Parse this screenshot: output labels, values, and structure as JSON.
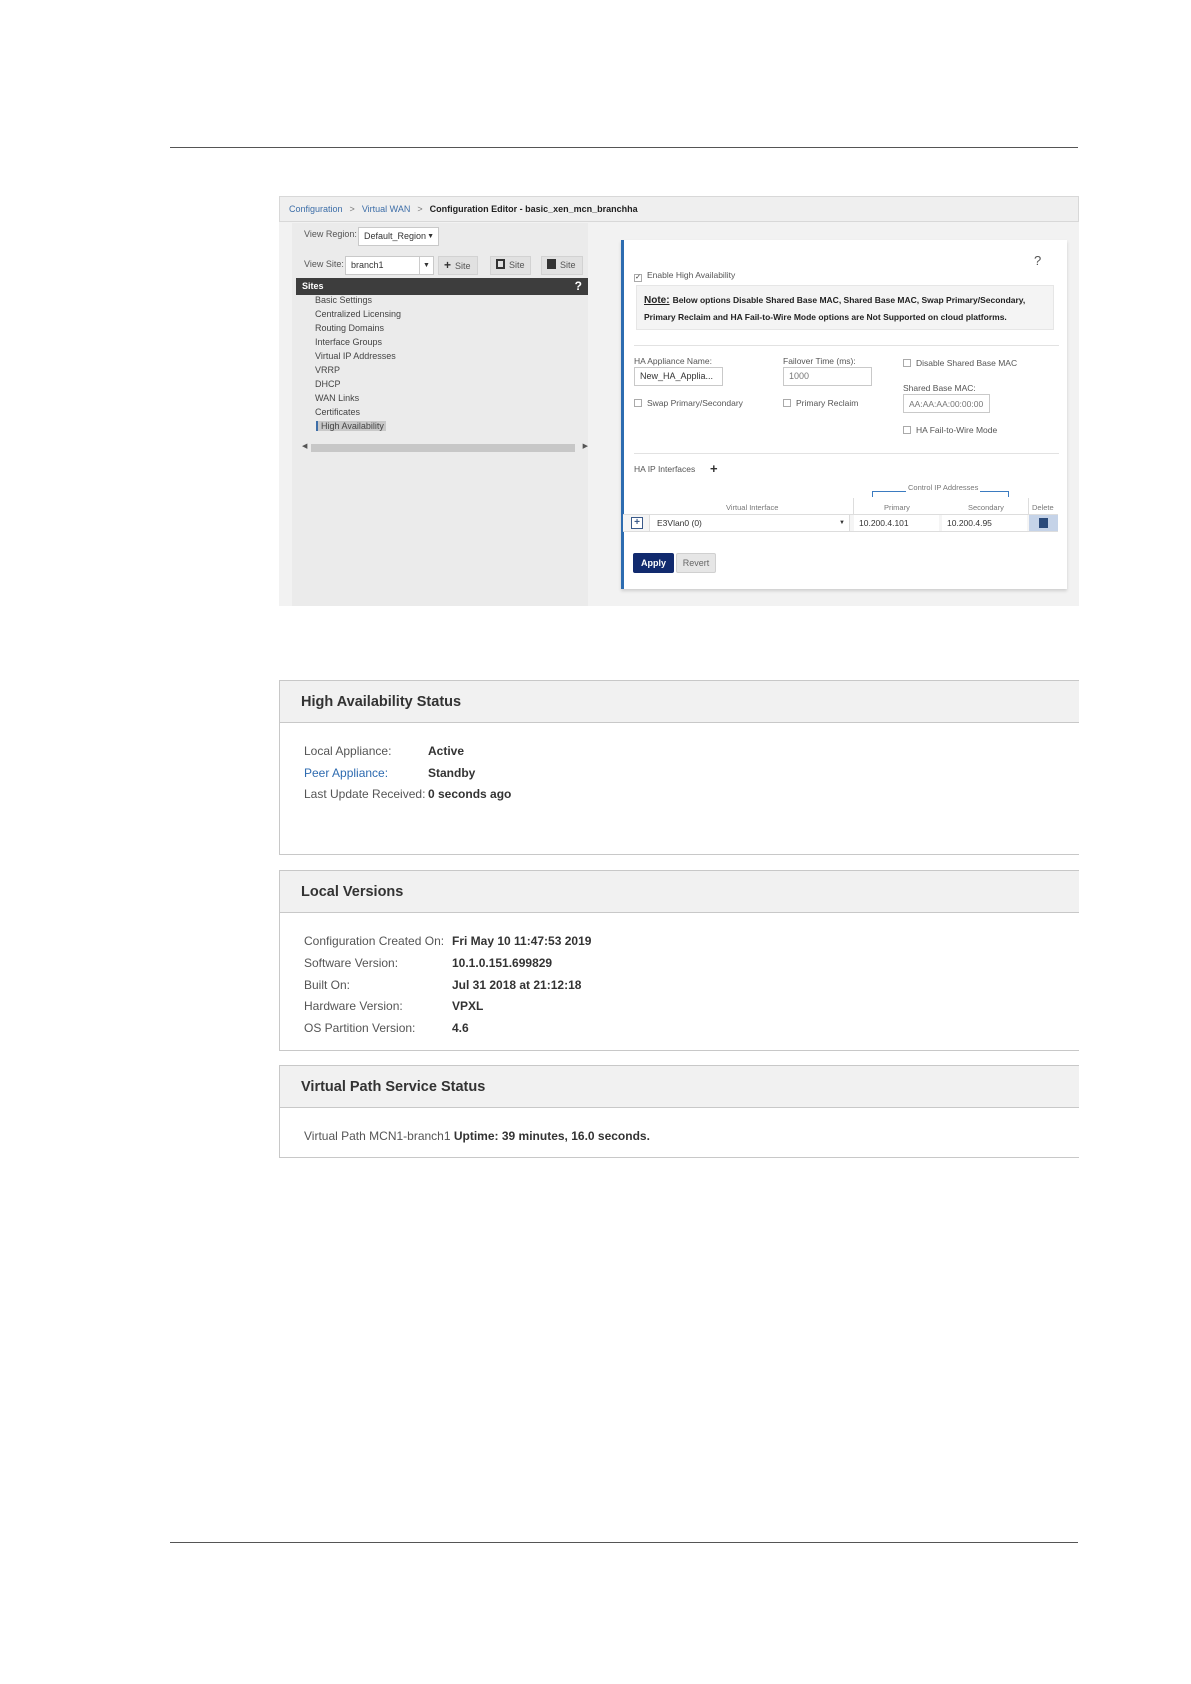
{
  "breadcrumb": {
    "items": [
      "Configuration",
      "Virtual WAN"
    ],
    "separator": ">",
    "current": "Configuration Editor - basic_xen_mcn_branchha"
  },
  "left_pane": {
    "view_region_label": "View Region:",
    "view_region_value": "Default_Region",
    "view_site_label": "View Site:",
    "view_site_value": "branch1",
    "toolbar": [
      {
        "icon": "plus-icon",
        "label": "Site"
      },
      {
        "icon": "copy-icon",
        "label": "Site"
      },
      {
        "icon": "trash-icon",
        "label": "Site"
      }
    ],
    "sites_header": "Sites",
    "help_glyph": "?",
    "sites": [
      "Basic Settings",
      "Centralized Licensing",
      "Routing Domains",
      "Interface Groups",
      "Virtual IP Addresses",
      "VRRP",
      "DHCP",
      "WAN Links",
      "Certificates",
      "High Availability"
    ],
    "selected_site": "High Availability"
  },
  "ha_form": {
    "help_glyph": "?",
    "enable_ha_label": "Enable High Availability",
    "enable_ha_checked": true,
    "note_heading": "Note:",
    "note_line1": "Below options Disable Shared Base MAC, Shared Base MAC, Swap Primary/Secondary,",
    "note_line2": "Primary Reclaim and HA Fail-to-Wire Mode options are Not Supported on cloud platforms.",
    "appliance_name_label": "HA Appliance Name:",
    "appliance_name_value": "New_HA_Applia...",
    "failover_time_label": "Failover Time (ms):",
    "failover_time_value": "1000",
    "disable_shared_mac_label": "Disable Shared Base MAC",
    "shared_base_mac_label": "Shared Base MAC:",
    "shared_base_mac_placeholder": "AA:AA:AA:00:00:00",
    "swap_label": "Swap Primary/Secondary",
    "primary_reclaim_label": "Primary Reclaim",
    "fail_to_wire_label": "HA Fail-to-Wire Mode",
    "ip_interfaces_label": "HA IP Interfaces",
    "add_glyph": "+",
    "table": {
      "group_header": "Control IP Addresses",
      "columns": [
        "Virtual Interface",
        "Primary",
        "Secondary",
        "Delete"
      ],
      "rows": [
        {
          "expand_glyph": "+",
          "virtual_interface": "E3Vlan0 (0)",
          "primary": "10.200.4.101",
          "secondary": "10.200.4.95"
        }
      ]
    },
    "apply_label": "Apply",
    "revert_label": "Revert"
  },
  "ha_status": {
    "title": "High Availability Status",
    "rows": [
      {
        "key": "Local Appliance:",
        "value": "Active"
      },
      {
        "key": "Peer Appliance:",
        "value": "Standby"
      },
      {
        "key": "Last Update Received:",
        "value": "0 seconds ago"
      }
    ]
  },
  "local_versions": {
    "title": "Local Versions",
    "rows": [
      {
        "key": "Configuration Created On:",
        "value": "Fri May 10 11:47:53 2019"
      },
      {
        "key": "Software Version:",
        "value": "10.1.0.151.699829"
      },
      {
        "key": "Built On:",
        "value": "Jul 31 2018 at 21:12:18"
      },
      {
        "key": "Hardware Version:",
        "value": "VPXL"
      },
      {
        "key": "OS Partition Version:",
        "value": "4.6"
      }
    ]
  },
  "virtual_path": {
    "title": "Virtual Path Service Status",
    "key": "Virtual Path MCN1-branch1",
    "value": "Uptime: 39 minutes, 16.0 seconds."
  }
}
